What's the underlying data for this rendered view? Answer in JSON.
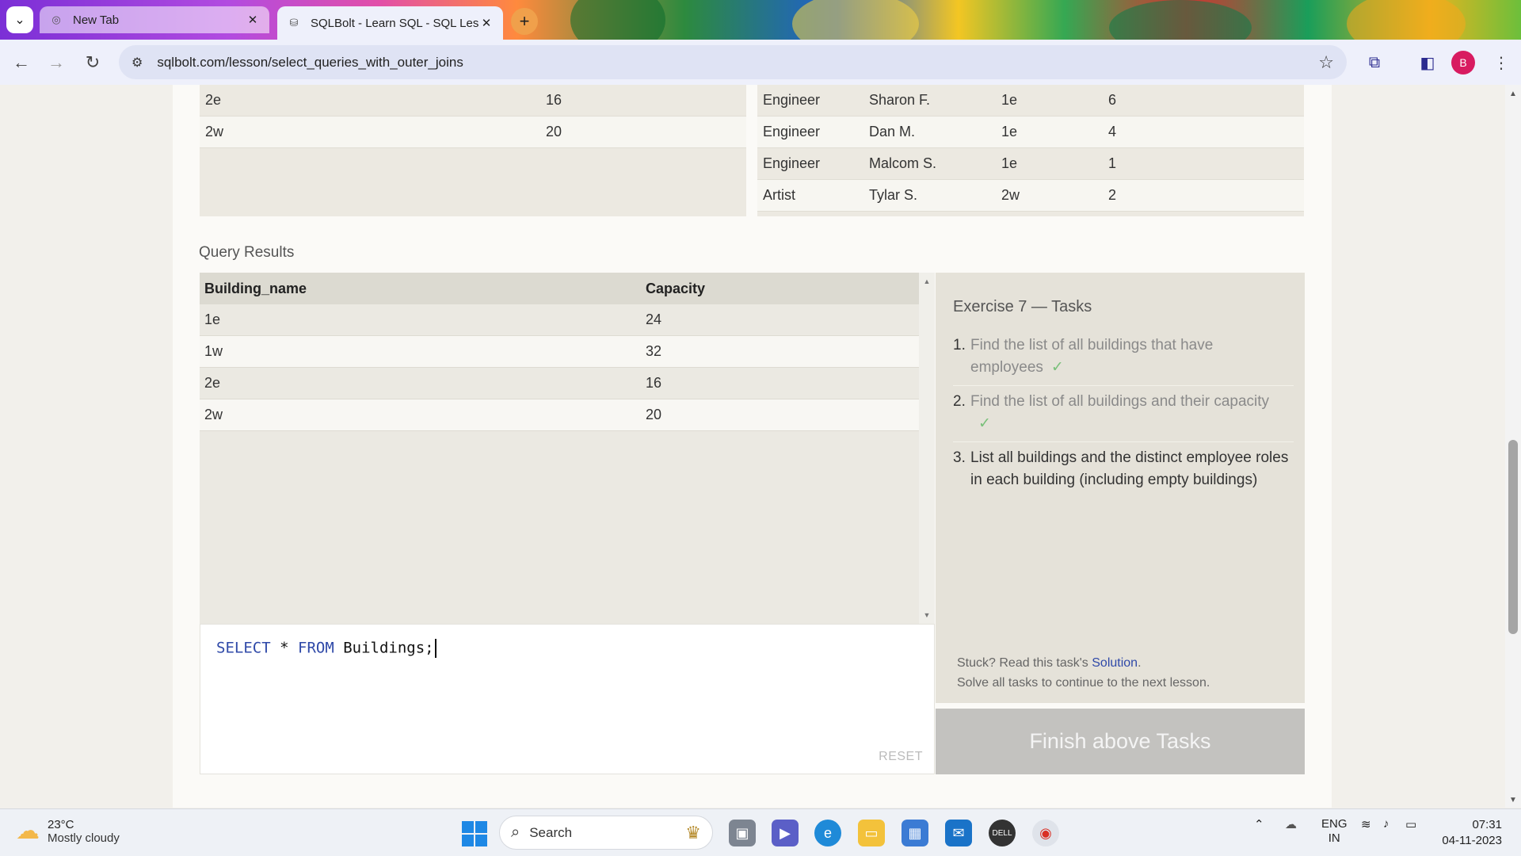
{
  "browser": {
    "tabs": [
      {
        "title": "New Tab",
        "active": false
      },
      {
        "title": "SQLBolt - Learn SQL - SQL Less",
        "active": true
      }
    ],
    "url": "sqlbolt.com/lesson/select_queries_with_outer_joins",
    "profile_initial": "B"
  },
  "top_left_table": {
    "rows": [
      [
        "2e",
        "16"
      ],
      [
        "2w",
        "20"
      ]
    ]
  },
  "top_right_table": {
    "rows": [
      [
        "Engineer",
        "Sharon F.",
        "1e",
        "6"
      ],
      [
        "Engineer",
        "Dan M.",
        "1e",
        "4"
      ],
      [
        "Engineer",
        "Malcom S.",
        "1e",
        "1"
      ],
      [
        "Artist",
        "Tylar S.",
        "2w",
        "2"
      ]
    ]
  },
  "query_results": {
    "label": "Query Results",
    "columns": [
      "Building_name",
      "Capacity"
    ],
    "rows": [
      [
        "1e",
        "24"
      ],
      [
        "1w",
        "32"
      ],
      [
        "2e",
        "16"
      ],
      [
        "2w",
        "20"
      ]
    ]
  },
  "editor": {
    "kw1": "SELECT",
    "star": "*",
    "kw2": "FROM",
    "table": "Buildings;",
    "reset_label": "RESET"
  },
  "exercise": {
    "title": "Exercise 7 — Tasks",
    "tasks": [
      {
        "num": "1.",
        "text": "Find the list of all buildings that have employees",
        "done": true
      },
      {
        "num": "2.",
        "text": "Find the list of all buildings and their capacity",
        "done": true
      },
      {
        "num": "3.",
        "text": "List all buildings and the distinct employee roles in each building (including empty buildings)",
        "done": false
      }
    ],
    "check_mark": "✓",
    "stuck_prefix": "Stuck? Read this task's ",
    "solution_link": "Solution",
    "stuck_suffix": ".",
    "continue_note": "Solve all tasks to continue to the next lesson.",
    "finish_button": "Finish above Tasks"
  },
  "taskbar": {
    "temperature": "23°C",
    "weather": "Mostly cloudy",
    "search_label": "Search",
    "lang_line1": "ENG",
    "lang_line2": "IN",
    "time": "07:31",
    "date": "04-11-2023"
  },
  "colors": {
    "accent_link": "#2f49a8",
    "check_green": "#79c07a",
    "finish_button_bg": "#c3c2bf"
  }
}
